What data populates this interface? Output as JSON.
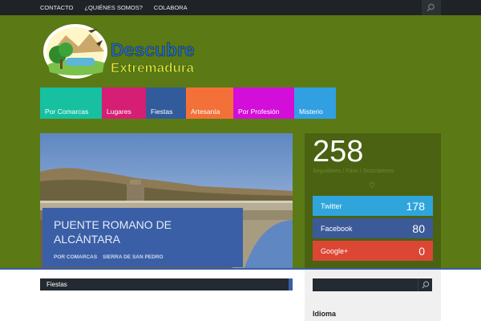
{
  "topnav": [
    "CONTACTO",
    "¿QUIÉNES SOMOS?",
    "COLABORA"
  ],
  "logo": {
    "line1": "Descubre",
    "line2": "Extremadura"
  },
  "categories": [
    "Por Comarcas",
    "Lugares",
    "Fiestas",
    "Artesanía",
    "Por Profesión",
    "Misterio"
  ],
  "hero": {
    "title": "PUENTE ROMANO DE ALCÁNTARA",
    "meta": [
      "POR COMARCAS",
      "SIERRA DE SAN PEDRO"
    ]
  },
  "social_widget": {
    "count": "258",
    "label": "Seguidores / Fans / Suscriptores",
    "items": [
      {
        "name": "Twitter",
        "value": "178",
        "color": "#2fa5dc"
      },
      {
        "name": "Facebook",
        "value": "80",
        "color": "#3c5a98"
      },
      {
        "name": "Google+",
        "value": "0",
        "color": "#dc4634"
      }
    ]
  },
  "section": {
    "title": "Fiestas"
  },
  "search": {
    "placeholder": ""
  },
  "sidebar": {
    "idioma": "Idioma"
  },
  "colors": {
    "background": "#5b7a15",
    "topbar": "#1f2326",
    "accent_blue": "#3a5fa6"
  }
}
